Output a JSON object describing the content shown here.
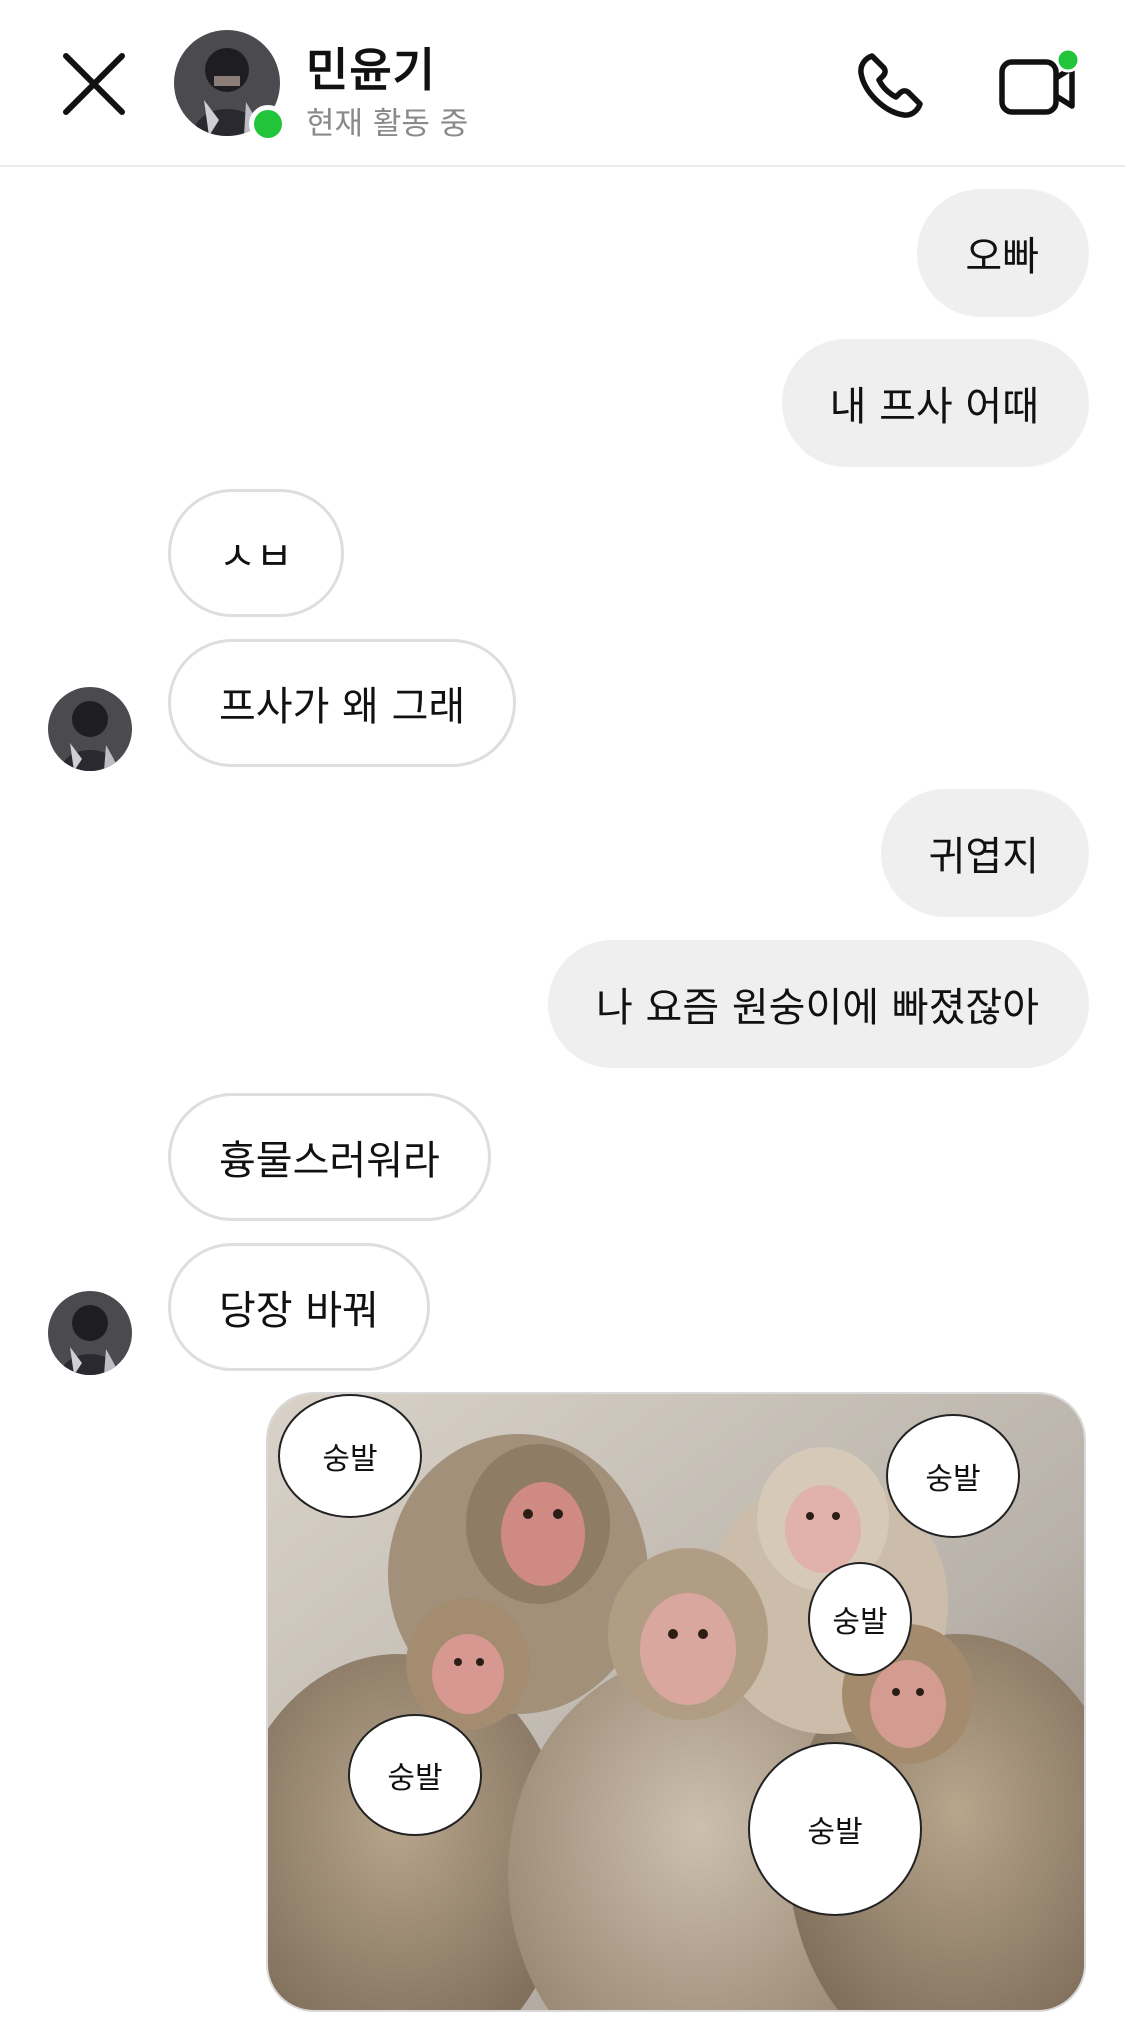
{
  "header": {
    "contact_name": "민윤기",
    "contact_status": "현재 활동 중",
    "close_icon": "close-icon",
    "call_icon": "phone-icon",
    "video_icon": "video-camera-icon"
  },
  "messages": [
    {
      "from": "me",
      "text": "오빠"
    },
    {
      "from": "me",
      "text": "내 프사 어때"
    },
    {
      "from": "them",
      "text": "ㅅㅂ"
    },
    {
      "from": "them",
      "text": "프사가 왜 그래"
    },
    {
      "from": "me",
      "text": "귀엽지"
    },
    {
      "from": "me",
      "text": "나 요즘 원숭이에 빠졌잖아"
    },
    {
      "from": "them",
      "text": "흉물스러워라"
    },
    {
      "from": "them",
      "text": "당장 바꿔"
    }
  ],
  "photo_message": {
    "bubbles": [
      "숭발",
      "숭발",
      "숭발",
      "숭발",
      "숭발"
    ]
  },
  "colors": {
    "online": "#22c53a",
    "sent_bubble": "#efefef",
    "received_border": "#dedede"
  }
}
